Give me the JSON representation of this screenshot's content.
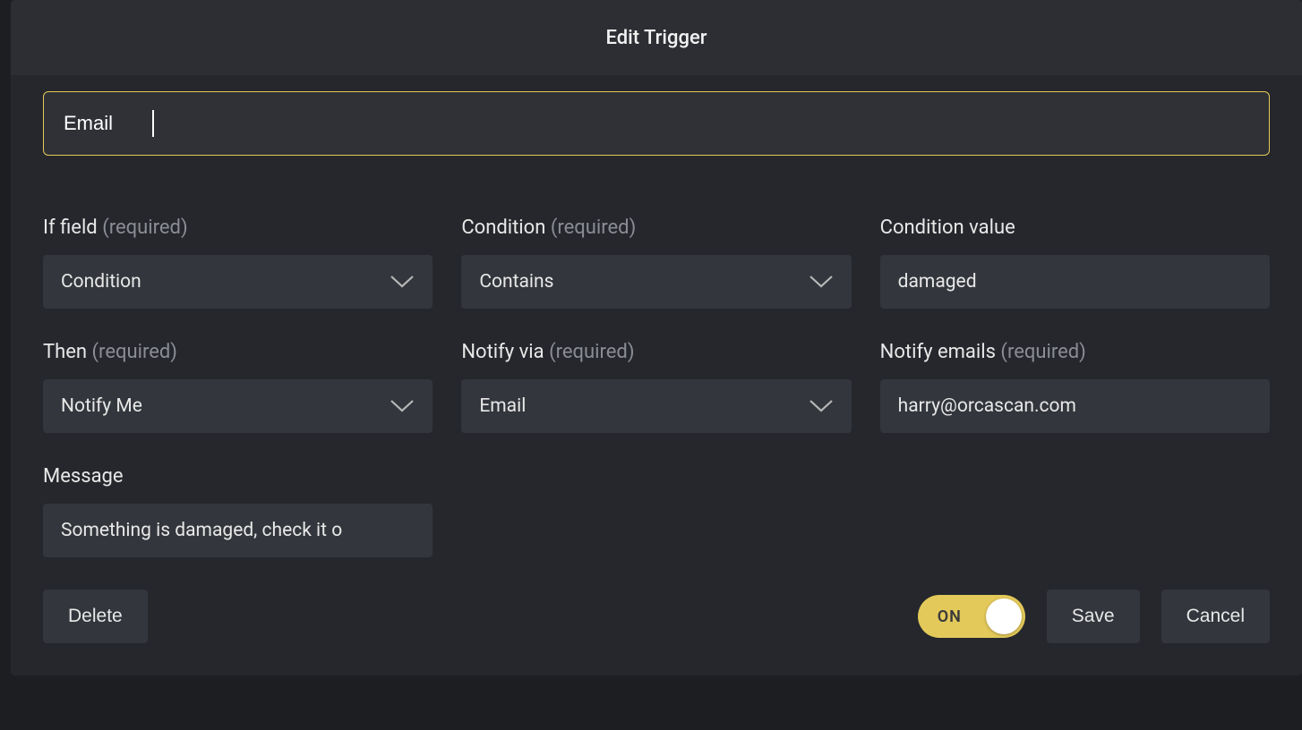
{
  "modal": {
    "title": "Edit Trigger",
    "name_value": "Email"
  },
  "fields": {
    "if_field": {
      "label": "If field",
      "required": "(required)",
      "value": "Condition"
    },
    "condition": {
      "label": "Condition",
      "required": "(required)",
      "value": "Contains"
    },
    "condition_value": {
      "label": "Condition value",
      "value": "damaged"
    },
    "then": {
      "label": "Then",
      "required": "(required)",
      "value": "Notify Me"
    },
    "notify_via": {
      "label": "Notify via",
      "required": "(required)",
      "value": "Email"
    },
    "notify_emails": {
      "label": "Notify emails",
      "required": "(required)",
      "value": "harry@orcascan.com"
    },
    "message": {
      "label": "Message",
      "value": "Something is damaged, check it o"
    }
  },
  "footer": {
    "delete": "Delete",
    "save": "Save",
    "cancel": "Cancel",
    "toggle_state": "ON"
  }
}
